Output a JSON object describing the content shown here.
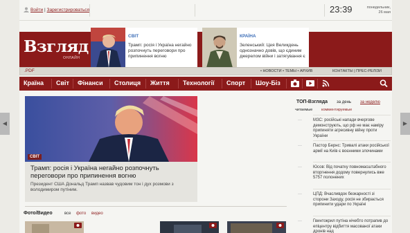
{
  "auth": {
    "login": "Войти",
    "separator": "|",
    "register": "Зарегистрироваться"
  },
  "clock": {
    "time": "23:39",
    "weekday": "понедельник,",
    "date": "26 мая"
  },
  "logo": {
    "title": "Взгляд",
    "subtitle": "ОНЛАЙН"
  },
  "promos": [
    {
      "tag": "СВІТ",
      "text": "Трамп: росія і Україна негайно розпочнуть переговори про припинення вогню"
    },
    {
      "tag": "КРАЇНА",
      "text": "Зеленський: Цея Великдень однозначно довів, що єдиним джерелом війни і затягування є"
    }
  ],
  "subbar": {
    "pdf": ".PDF",
    "menu": "• НОВОСТИ  • ТЕМЫ  • АРХИВ",
    "contacts": "КОНТАКТЫ | ПРЕС-РЕЛІЗИ"
  },
  "nav": [
    "Країна",
    "Світ",
    "Фінанси",
    "Столиця",
    "Життя",
    "Технології",
    "Спорт",
    "Шоу-Біз"
  ],
  "hero": {
    "tag": "СВІТ",
    "title": "Трамп: росія і Україна негайно розпочнуть переговори про припинення вогню",
    "subtitle": "Президент США Дональд Трамп назвав чудовим тон і дух розмови з володимиром путіним."
  },
  "photo_video": {
    "title": "Фото/Видео",
    "tabs": [
      "все",
      "фото",
      "видео"
    ]
  },
  "top": {
    "title": "ТОП-Взгляда",
    "day": "за день",
    "week": "за неделю",
    "read": "читаемые",
    "commented": "комментируемые",
    "items": [
      "МЗС: російські напади вчергове демонструють, що рф не має наміру припиняти агресивну війну проти України",
      "Пастор Бернс: Тривалі атаки російської армії на Київ є воєнними злочинами",
      "Юсов: Від початку повномасштабного вторгнення додому повернулись вже 5757 полонених",
      "ЦПД: Вчасливдок безкарності зі сторони Заходу, росія не збирається припинити удари по Україні",
      "Гвинтокрил путіна нічебто потрапив до епіцентру відбиття масованої атаки дронів над"
    ]
  },
  "colors": {
    "brand": "#8b1a1a",
    "accent_blue": "#3e6fb8",
    "background": "#f5f5f2"
  }
}
